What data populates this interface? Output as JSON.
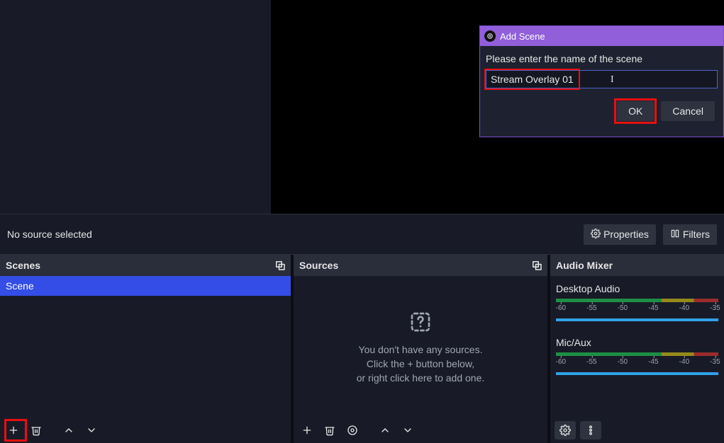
{
  "source_bar": {
    "status": "No source selected",
    "properties_label": "Properties",
    "filters_label": "Filters"
  },
  "scenes": {
    "header": "Scenes",
    "items": [
      {
        "label": "Scene"
      }
    ]
  },
  "sources": {
    "header": "Sources",
    "empty_line1": "You don't have any sources.",
    "empty_line2": "Click the + button below,",
    "empty_line3": "or right click here to add one."
  },
  "mixer": {
    "header": "Audio Mixer",
    "channels": [
      {
        "label": "Desktop Audio"
      },
      {
        "label": "Mic/Aux"
      }
    ],
    "ticks": [
      "-60",
      "-55",
      "-50",
      "-45",
      "-40",
      "-35"
    ]
  },
  "dialog": {
    "title": "Add Scene",
    "prompt": "Please enter the name of the scene",
    "input_value": "Stream Overlay 01",
    "ok": "OK",
    "cancel": "Cancel"
  }
}
